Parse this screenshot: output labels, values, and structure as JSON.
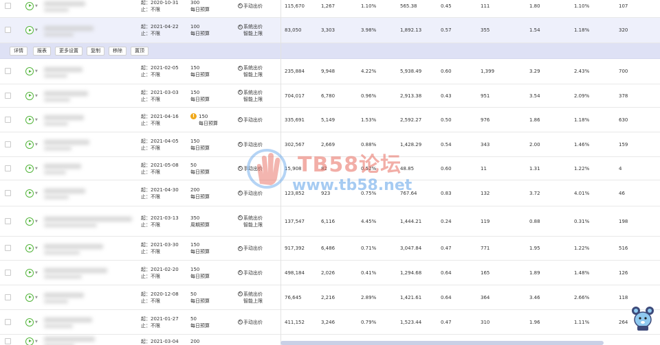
{
  "action_bar": {
    "buttons": [
      "详情",
      "报表",
      "更多设置",
      "复制",
      "移除",
      "置顶"
    ]
  },
  "labels": {
    "start_prefix": "起：",
    "end_prefix": "止："
  },
  "rows": [
    {
      "start": "2020-10-31",
      "end": "不限",
      "budget": "300",
      "budget_type": "每日预算",
      "bid": "手动出价",
      "bid2": "",
      "c1": "115,670",
      "c2": "1,267",
      "c3": "1.10%",
      "c4": "565.38",
      "c5": "0.45",
      "c6": "111",
      "c7": "1.80",
      "c8": "1.10%",
      "c9": "107",
      "warn": false,
      "hl": false
    },
    {
      "start": "2021-04-22",
      "end": "不限",
      "budget": "100",
      "budget_type": "每日预算",
      "bid": "系统出价",
      "bid2": "智能上限",
      "c1": "83,050",
      "c2": "3,303",
      "c3": "3.98%",
      "c4": "1,892.13",
      "c5": "0.57",
      "c6": "355",
      "c7": "1.54",
      "c8": "1.18%",
      "c9": "320",
      "warn": false,
      "hl": true
    },
    {
      "start": "2021-02-05",
      "end": "不限",
      "budget": "150",
      "budget_type": "每日预算",
      "bid": "系统出价",
      "bid2": "智能上限",
      "c1": "235,884",
      "c2": "9,948",
      "c3": "4.22%",
      "c4": "5,938.49",
      "c5": "0.60",
      "c6": "1,399",
      "c7": "3.29",
      "c8": "2.43%",
      "c9": "700",
      "warn": false,
      "hl": false
    },
    {
      "start": "2021-03-03",
      "end": "不限",
      "budget": "150",
      "budget_type": "每日预算",
      "bid": "系统出价",
      "bid2": "智能上限",
      "c1": "704,017",
      "c2": "6,780",
      "c3": "0.96%",
      "c4": "2,913.38",
      "c5": "0.43",
      "c6": "951",
      "c7": "3.54",
      "c8": "2.09%",
      "c9": "378",
      "warn": false,
      "hl": false
    },
    {
      "start": "2021-04-16",
      "end": "不限",
      "budget": "150",
      "budget_type": "每日预算",
      "bid": "手动出价",
      "bid2": "",
      "c1": "335,691",
      "c2": "5,149",
      "c3": "1.53%",
      "c4": "2,592.27",
      "c5": "0.50",
      "c6": "976",
      "c7": "1.86",
      "c8": "1.18%",
      "c9": "630",
      "warn": true,
      "hl": false
    },
    {
      "start": "2021-04-05",
      "end": "不限",
      "budget": "150",
      "budget_type": "每日预算",
      "bid": "手动出价",
      "bid2": "",
      "c1": "302,567",
      "c2": "2,669",
      "c3": "0.88%",
      "c4": "1,428.29",
      "c5": "0.54",
      "c6": "343",
      "c7": "2.00",
      "c8": "1.46%",
      "c9": "159",
      "warn": false,
      "hl": false
    },
    {
      "start": "2021-05-08",
      "end": "不限",
      "budget": "50",
      "budget_type": "每日预算",
      "bid": "手动出价",
      "bid2": "",
      "c1": "15,908",
      "c2": "82",
      "c3": "0.52%",
      "c4": "48.85",
      "c5": "0.60",
      "c6": "11",
      "c7": "1.31",
      "c8": "1.22%",
      "c9": "4",
      "warn": false,
      "hl": false
    },
    {
      "start": "2021-04-30",
      "end": "不限",
      "budget": "200",
      "budget_type": "每日预算",
      "bid": "手动出价",
      "bid2": "",
      "c1": "123,852",
      "c2": "923",
      "c3": "0.75%",
      "c4": "767.64",
      "c5": "0.83",
      "c6": "132",
      "c7": "3.72",
      "c8": "4.01%",
      "c9": "46",
      "warn": false,
      "hl": false
    },
    {
      "start": "2021-03-13",
      "end": "不限",
      "budget": "350",
      "budget_type": "周期预算",
      "bid": "系统出价",
      "bid2": "智能上限",
      "c1": "137,547",
      "c2": "6,116",
      "c3": "4.45%",
      "c4": "1,444.21",
      "c5": "0.24",
      "c6": "119",
      "c7": "0.88",
      "c8": "0.31%",
      "c9": "198",
      "warn": false,
      "hl": false
    },
    {
      "start": "2021-03-30",
      "end": "不限",
      "budget": "150",
      "budget_type": "每日预算",
      "bid": "手动出价",
      "bid2": "",
      "c1": "917,392",
      "c2": "6,486",
      "c3": "0.71%",
      "c4": "3,047.84",
      "c5": "0.47",
      "c6": "771",
      "c7": "1.95",
      "c8": "1.22%",
      "c9": "516",
      "warn": false,
      "hl": false
    },
    {
      "start": "2021-02-20",
      "end": "不限",
      "budget": "150",
      "budget_type": "每日预算",
      "bid": "手动出价",
      "bid2": "",
      "c1": "498,184",
      "c2": "2,026",
      "c3": "0.41%",
      "c4": "1,294.68",
      "c5": "0.64",
      "c6": "165",
      "c7": "1.89",
      "c8": "1.48%",
      "c9": "126",
      "warn": false,
      "hl": false
    },
    {
      "start": "2020-12-08",
      "end": "不限",
      "budget": "50",
      "budget_type": "每日预算",
      "bid": "系统出价",
      "bid2": "智能上限",
      "c1": "76,645",
      "c2": "2,216",
      "c3": "2.89%",
      "c4": "1,421.61",
      "c5": "0.64",
      "c6": "364",
      "c7": "3.46",
      "c8": "2.66%",
      "c9": "118",
      "warn": false,
      "hl": false
    },
    {
      "start": "2021-01-27",
      "end": "不限",
      "budget": "50",
      "budget_type": "每日预算",
      "bid": "手动出价",
      "bid2": "",
      "c1": "411,152",
      "c2": "3,246",
      "c3": "0.79%",
      "c4": "1,523.44",
      "c5": "0.47",
      "c6": "310",
      "c7": "1.96",
      "c8": "1.11%",
      "c9": "264",
      "warn": false,
      "hl": false
    },
    {
      "start": "2021-03-04",
      "end": "",
      "budget": "200",
      "budget_type": "",
      "bid": "",
      "bid2": "",
      "c1": "",
      "c2": "",
      "c3": "",
      "c4": "",
      "c5": "",
      "c6": "",
      "c7": "",
      "c8": "",
      "c9": "",
      "warn": false,
      "hl": false
    }
  ],
  "watermark": {
    "line1": "TB58论坛",
    "line2": "www.tb58.net"
  },
  "colors": {
    "accent_green": "#52b43a",
    "highlight_row": "#eef0fb",
    "action_bar": "#dee1f5",
    "warning": "#f0a818"
  }
}
